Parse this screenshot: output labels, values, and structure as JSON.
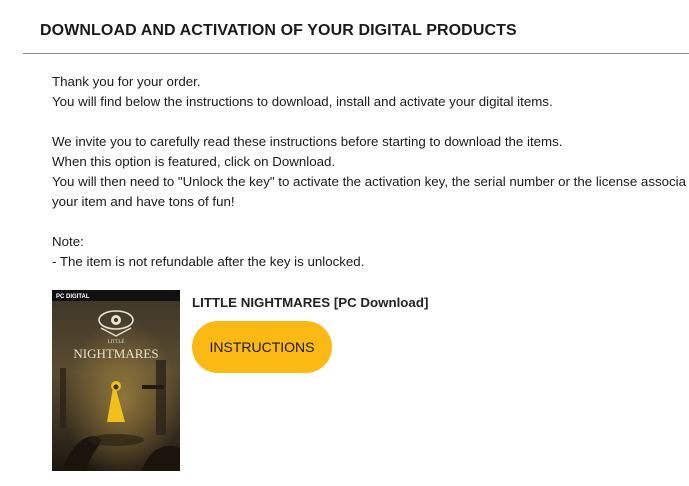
{
  "header": {
    "title": "DOWNLOAD AND ACTIVATION OF YOUR DIGITAL PRODUCTS"
  },
  "intro": {
    "lines": [
      "Thank you for your order.",
      "You will find below the instructions to download, install and activate your digital items.",
      "We invite you to carefully read these instructions before starting to download the items.",
      "When this option is featured, click on Download.",
      "You will then need to \"Unlock the key\" to activate the activation key, the serial number or the license associa",
      "your item and have tons of fun!",
      "Note:",
      "- The item is not refundable after the key is unlocked."
    ]
  },
  "product": {
    "title": "LITTLE NIGHTMARES [PC Download]",
    "button_label": "INSTRUCTIONS",
    "cover": {
      "badge": "PC DIGITAL",
      "logo_small": "LITTLE",
      "logo_big": "NIGHTMARES"
    }
  },
  "colors": {
    "accent": "#fcb813",
    "divider": "#8c8c8c",
    "text": "#1a1a1a"
  }
}
